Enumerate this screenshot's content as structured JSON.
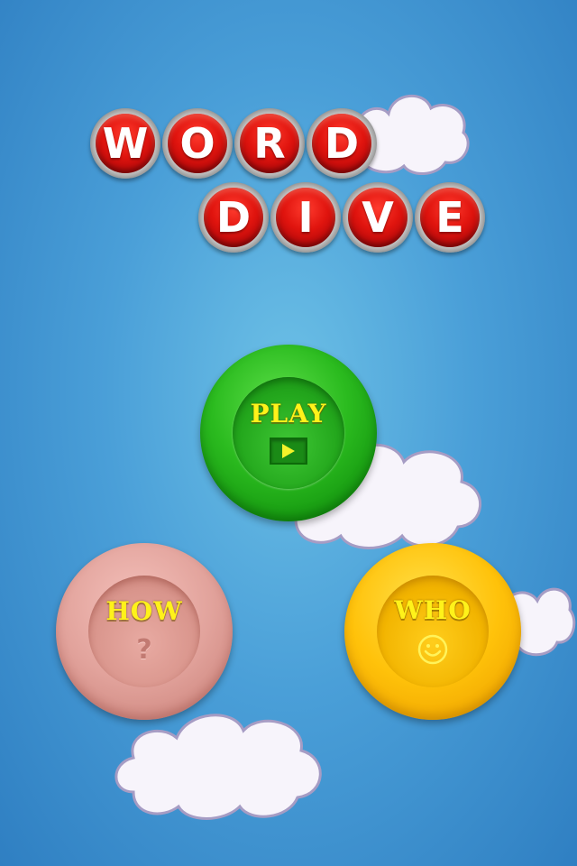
{
  "title": {
    "word": [
      "W",
      "O",
      "R",
      "D"
    ],
    "dive": [
      "D",
      "I",
      "V",
      "E"
    ]
  },
  "buttons": {
    "play": {
      "label": "PLAY",
      "icon": "play-triangle-icon"
    },
    "how": {
      "label": "HOW",
      "icon": "question-mark-icon",
      "glyph": "?"
    },
    "who": {
      "label": "WHO",
      "icon": "smiley-face-icon"
    }
  },
  "colors": {
    "background": "#4a9fd8",
    "title_ball": "#e0140e",
    "play": "#2bbb1f",
    "how": "#e2a39c",
    "who": "#ffc20a",
    "label_text": "#fff21a"
  }
}
